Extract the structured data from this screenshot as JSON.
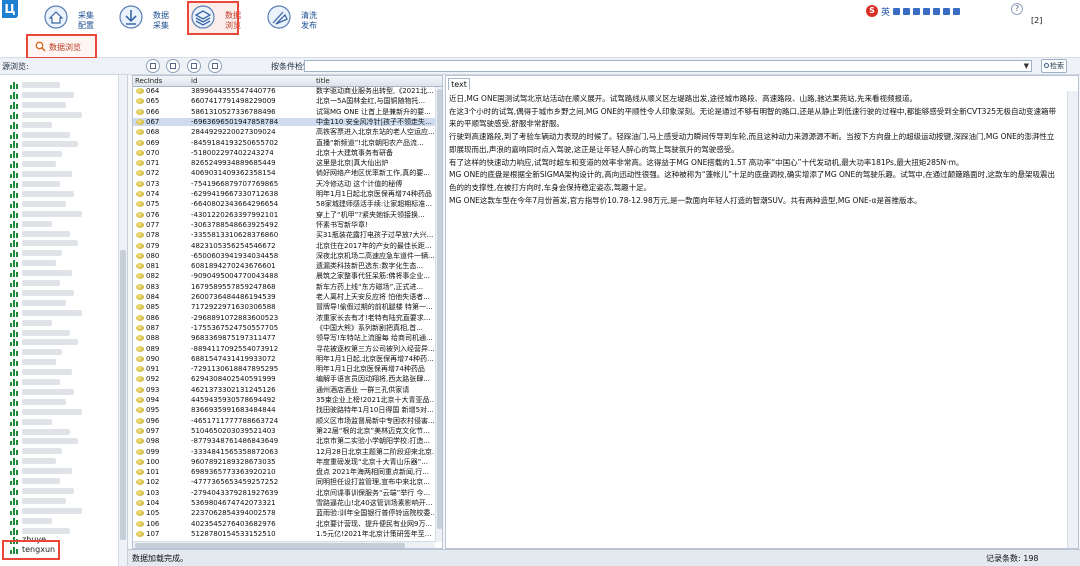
{
  "toolbar": {
    "buttons": [
      {
        "label": "采集\n配置",
        "active": false
      },
      {
        "label": "数据\n采集",
        "active": false
      },
      {
        "label": "数据\n浏览",
        "active": true
      },
      {
        "label": "清洗\n发布",
        "active": false
      }
    ],
    "tray_text": "英",
    "count": "[2]"
  },
  "browse_tab": {
    "label": "数据浏览"
  },
  "query": {
    "source_label": "源浏览:",
    "search_label": "按条件检索:",
    "search_button": "检索"
  },
  "tree": {
    "items": [
      "",
      "",
      "",
      "",
      "",
      "",
      "",
      "",
      "",
      "",
      "",
      "",
      "",
      "",
      "",
      "",
      "",
      "",
      "",
      "",
      "",
      "",
      "",
      "",
      "",
      "",
      "",
      "",
      "",
      "",
      "",
      "",
      "",
      "",
      "",
      "",
      "",
      "",
      "",
      "",
      "",
      "",
      "",
      "",
      "",
      "",
      "zhuye",
      "tengxun"
    ]
  },
  "grid": {
    "columns": [
      "RecInds",
      "id",
      "title"
    ],
    "selected_index": 3,
    "rows": [
      [
        "064",
        "3899644355547440776",
        "数字驱动商业服务出转型,《2021北..."
      ],
      [
        "065",
        "6607417791498229009",
        "北京一5A国林金红,与国铜随物托..."
      ],
      [
        "066",
        "5861310527336788496",
        "试驾MG ONE 让首上是兼新升的要..."
      ],
      [
        "067",
        "-6963696501947858784",
        "中金110 安全风冷针|孩子不领走失..."
      ],
      [
        "068",
        "2844929220027309024",
        "高铁客票进入北京东站的老人空运应..."
      ],
      [
        "069",
        "-8459184193250655702",
        "直播“新频道”!北京朝阳农产品流..."
      ],
      [
        "070",
        "-518002297402243274",
        "北京十大建筑事务有研备"
      ],
      [
        "071",
        "8265249934889685449",
        "这里是北京|真大仙出炉"
      ],
      [
        "072",
        "4069031409362358154",
        "倘好网络产地区优率新工作,真的要..."
      ],
      [
        "073",
        "-7541966879707769865",
        "天冷修达动 这个计值的秘傅"
      ],
      [
        "074",
        "-6299419667330712638",
        "明年1月1日起北京医保再增74种药品"
      ],
      [
        "075",
        "-6640802343664296654",
        "58家城建师感活手续:让家超期标准..."
      ],
      [
        "076",
        "-4301220263397992101",
        "穿上了“机甲”?紧夹她铄天领接换..."
      ],
      [
        "077",
        "-3063788548663925492",
        "怀素书写新华章!"
      ],
      [
        "078",
        "-3355813310628376860",
        "买31瓶装花露打电孩子过早放?大兴..."
      ],
      [
        "079",
        "4823105356254546672",
        "北京住在2017年的产女的最佳长距..."
      ],
      [
        "080",
        "-6500603941934034458",
        "深夜北京机场二高速应急车道件一辆..."
      ],
      [
        "081",
        "6081894270243676601",
        "遗漏类科技新巴选东:数字化生态..."
      ],
      [
        "082",
        "-9090495004770043488",
        "晨筑之家整事代狂呆筋:佛将事企业..."
      ],
      [
        "083",
        "1679589557859247868",
        "新车方药上线“东方磁场”,正式进..."
      ],
      [
        "084",
        "2600736484486194539",
        "老人离村上天安反应将 怕他失语者..."
      ],
      [
        "085",
        "7172922971630306588",
        "冒牌导!偷假过期的前机腿楼 特第一..."
      ],
      [
        "086",
        "-2968891072883600523",
        "浓重家长去有才!老特有陆究直要求..."
      ],
      [
        "087",
        "-1755367524750557705",
        "《中国大熊》系列新剧把真相,首..."
      ],
      [
        "088",
        "9683369875197311477",
        "领导写!车特站上流服每 给商司机通..."
      ],
      [
        "089",
        "-8894117092554073912",
        "寻花被逐权第三方公司被列入经营异..."
      ],
      [
        "090",
        "6881547431419933072",
        "明年1月1日起,北京医保再增74种药..."
      ],
      [
        "091",
        "-7291130618847895295",
        "明年1月1日北京医保再增74种药品"
      ],
      [
        "092",
        "6294308402540591999",
        "编解手语言员因动翔将,西太路张肆..."
      ],
      [
        "093",
        "4621373302131245126",
        "通州酒店酒业 一群三孔供家请"
      ],
      [
        "094",
        "4459435930578694492",
        "35束企业上榜!2021北京十大青亚品..."
      ],
      [
        "095",
        "8366935991683484844",
        "找田驶路特年1月10日得国 新增5对..."
      ],
      [
        "096",
        "-4651711777788663724",
        "顺义区市场监督局新中专困农村侵害..."
      ],
      [
        "097",
        "5104650203039521403",
        "第22届“根的北京”美林迈克文化节..."
      ],
      [
        "098",
        "-8779348761486843649",
        "北京市第二实验小学朝阳学校:打造..."
      ],
      [
        "099",
        "-3334841565358872063",
        "12月28日北京主题第二阶段迎来北京..."
      ],
      [
        "100",
        "9607892189328673035",
        "年度重磅发现“北京十大青山乐器”..."
      ],
      [
        "101",
        "6989365773363920210",
        "盘点 2021年海两相同重点新闻,行..."
      ],
      [
        "102",
        "-4777365653459257252",
        "同明担任设打监管理,宣布中来北京..."
      ],
      [
        "103",
        "-2794043379281927639",
        "北京间谍事训保服务“云端”举行 今..."
      ],
      [
        "104",
        "5369804674742073321",
        "雪路逼花山!北40这管训场素影响开..."
      ],
      [
        "105",
        "2237062854394002578",
        "蓝雨验:训年全国银行普停铃运院校委..."
      ],
      [
        "106",
        "4023545276403682976",
        "北京要计营现、提升便民有业网9万..."
      ],
      [
        "107",
        "5128780154533152510",
        "1.5元亿!2021年北京计策研签年至..."
      ]
    ]
  },
  "text_panel": {
    "tab_label": "text",
    "paragraphs": [
      "近日,MG ONE国测试驾北京站活动在顺义展开。试驾路线从顺义区左堤路出发,途径城市路段、高速路段、山路,驰达果苑站,先来看视频报道。",
      "在这3个小时的试驾,偶得于城市乡野之间,MG ONE的平顺性令人印象深刻。无论是通过不够有明智的路口,还是从静止到低速行驶的过程中,都能够感受到全新CVT325无极自动变速箱带来的平顺驾驶感受,舒服非常舒服。",
      "行驶到高速路段,到了考验车辆动力表现的时候了。轻踩油门,马上感受动力瞬间传导到车轮,而且这种动力来源源源不断。当按下方向盘上的超级运动按键,深踩油门,MG ONE的澎湃性立即展现而出,声浪的嘉响同时点入驾驶,这正是让年轻人醉心的驾上驾驶氛升的驾驶感受。",
      "有了这样的快速动力响应,试驾时超车和变道的效率非常高。这得益于MG ONE搭载的1.5T 高功率“中国心”十代发动机,最大功率181Ps,最大扭矩285N·m。",
      "MG ONE的底盘是根据全新SIGMA架构设计的,高向迅动性很强。这种被称为“蓬帐儿”十足的底盘调校,确实增添了MG ONE的驾驶乐趣。试驾中,在通过颠簸路面时,这款车的悬架吸震出色的的支撑性,在被打方向时,车身会保持稳定姿态,驾趣十足。",
      "MG ONE这款车型在今年7月份首发,官方指导价10.78-12.98万元,是一款面向年轻人打造的智潮SUV。共有两种造型,MG ONE-α是首推版本。"
    ]
  },
  "status": {
    "left": "数据加载完成。",
    "right": "记录条数: 198"
  },
  "colors": {
    "accent_red": "#e8473a",
    "toolbar_blue": "#1d4f92",
    "selected_row": "#cfdcef"
  }
}
